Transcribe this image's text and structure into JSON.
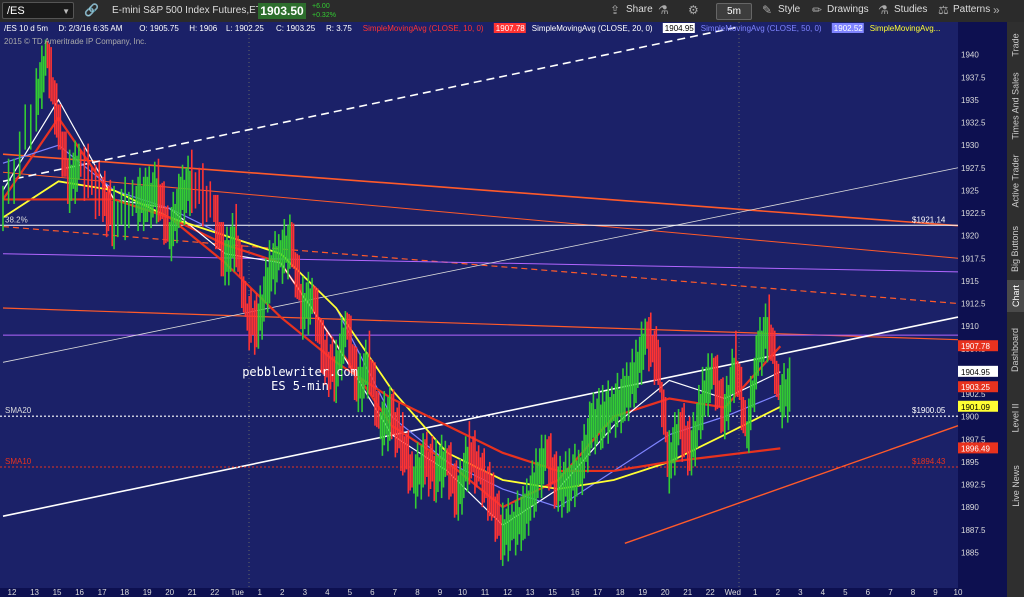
{
  "toolbar": {
    "symbol": "/ES",
    "title": "E-mini S&P 500 Index Futures,ETH",
    "last_price": "1903.50",
    "change_lines": [
      "+6.00",
      "+0.32%"
    ],
    "buttons": {
      "share": "Share",
      "style": "Style",
      "drawings": "Drawings",
      "studies": "Studies",
      "patterns": "Patterns"
    },
    "timeframe": "5m"
  },
  "sidebar": {
    "tabs": [
      "Trade",
      "Times And Sales",
      "Active Trader",
      "Big Buttons",
      "Chart",
      "Dashboard",
      "Level II",
      "Live News"
    ],
    "active": "Chart"
  },
  "header": {
    "info": [
      "/ES 10 d 5m",
      "D: 2/3/16 6:35 AM",
      "O: 1905.75",
      "H: 1906",
      "L: 1902.25",
      "C: 1903.25",
      "R: 3.75"
    ],
    "studies": [
      {
        "label": "SimpleMovingAvg (CLOSE, 10, 0)",
        "value": "1907.78",
        "color": "#ff3333"
      },
      {
        "label": "SimpleMovingAvg (CLOSE, 20, 0)",
        "value": "1904.95",
        "color": "#ffffff"
      },
      {
        "label": "SimpleMovingAvg (CLOSE, 50, 0)",
        "value": "1902.52",
        "color": "#7f84ff"
      },
      {
        "label": "SimpleMovingAvg...",
        "value": "",
        "color": "#ffff33"
      }
    ],
    "copyright": "2015 © TD Ameritrade IP Company, Inc."
  },
  "annotations": {
    "watermark": [
      "pebblewriter.com",
      "ES 5-min"
    ],
    "fib": "38.2%",
    "sma20": "SMA20",
    "sma10": "SMA10",
    "level_1921": "$1921.14",
    "level_1900": "$1900.05",
    "level_1894": "$1894.43"
  },
  "chart_data": {
    "type": "line",
    "title": "/ES 10 d 5m",
    "xlabel": "",
    "ylabel": "",
    "ylim": [
      1882.5,
      1942.5
    ],
    "grid": false,
    "y_ticks": [
      "1885",
      "1887.5",
      "1890",
      "1892.5",
      "1895",
      "1897.5",
      "1900",
      "1902.5",
      "1905",
      "1907.5",
      "1910",
      "1912.5",
      "1915",
      "1917.5",
      "1920",
      "1922.5",
      "1925",
      "1927.5",
      "1930",
      "1932.5",
      "1935",
      "1937.5",
      "1940"
    ],
    "x_ticks": [
      "12",
      "13",
      "15",
      "16",
      "17",
      "18",
      "19",
      "20",
      "21",
      "22",
      "Tue",
      "1",
      "2",
      "3",
      "4",
      "5",
      "6",
      "7",
      "8",
      "9",
      "10",
      "11",
      "12",
      "13",
      "15",
      "16",
      "17",
      "18",
      "19",
      "20",
      "21",
      "22",
      "Wed",
      "1",
      "2",
      "3",
      "4",
      "5",
      "6",
      "7",
      "8",
      "9",
      "10"
    ],
    "price_badges": [
      {
        "value": "1907.78",
        "color": "#e8321e",
        "text_color": "#ffffff"
      },
      {
        "value": "1904.95",
        "color": "#ffffff",
        "text_color": "#000000"
      },
      {
        "value": "1903.25",
        "color": "#e8321e",
        "text_color": "#ffffff"
      },
      {
        "value": "1901.09",
        "color": "#ffff33",
        "text_color": "#000000"
      },
      {
        "value": "1896.49",
        "color": "#e8321e",
        "text_color": "#ffffff"
      }
    ],
    "price_series": [
      [
        0,
        1923
      ],
      [
        3,
        1935
      ],
      [
        4,
        1940
      ],
      [
        5,
        1932
      ],
      [
        6,
        1926
      ],
      [
        7,
        1928
      ],
      [
        9,
        1924
      ],
      [
        10,
        1922
      ],
      [
        12,
        1924
      ],
      [
        13,
        1924
      ],
      [
        14,
        1925
      ],
      [
        15,
        1920
      ],
      [
        16,
        1924
      ],
      [
        17,
        1926
      ],
      [
        19,
        1923
      ],
      [
        20,
        1917
      ],
      [
        21,
        1920
      ],
      [
        22,
        1911
      ],
      [
        23,
        1910
      ],
      [
        24,
        1916
      ],
      [
        25,
        1918
      ],
      [
        26,
        1919
      ],
      [
        27,
        1912
      ],
      [
        28,
        1913
      ],
      [
        29,
        1906
      ],
      [
        30,
        1905
      ],
      [
        31,
        1910
      ],
      [
        32,
        1903
      ],
      [
        33,
        1906
      ],
      [
        34,
        1899
      ],
      [
        35,
        1900
      ],
      [
        36,
        1897
      ],
      [
        37,
        1893
      ],
      [
        38,
        1895
      ],
      [
        39,
        1894
      ],
      [
        40,
        1895
      ],
      [
        41,
        1891
      ],
      [
        42,
        1896
      ],
      [
        43,
        1894
      ],
      [
        44,
        1891
      ],
      [
        45,
        1887
      ],
      [
        46,
        1888
      ],
      [
        47,
        1889
      ],
      [
        48,
        1893
      ],
      [
        49,
        1896
      ],
      [
        50,
        1892
      ],
      [
        51,
        1893
      ],
      [
        52,
        1894
      ],
      [
        53,
        1899
      ],
      [
        54,
        1900
      ],
      [
        55,
        1901
      ],
      [
        56,
        1902
      ],
      [
        57,
        1905
      ],
      [
        58,
        1909
      ],
      [
        59,
        1906
      ],
      [
        60,
        1895
      ],
      [
        61,
        1899
      ],
      [
        62,
        1896
      ],
      [
        63,
        1902
      ],
      [
        64,
        1905
      ],
      [
        65,
        1900
      ],
      [
        66,
        1906
      ],
      [
        67,
        1898
      ],
      [
        68,
        1907
      ],
      [
        69,
        1910
      ],
      [
        70,
        1902
      ],
      [
        71,
        1903.25
      ]
    ],
    "series": [
      {
        "name": "SMA 10",
        "color": "#e83222",
        "values": [
          [
            0,
            1924
          ],
          [
            5,
            1933
          ],
          [
            10,
            1924
          ],
          [
            15,
            1922
          ],
          [
            20,
            1919
          ],
          [
            25,
            1917
          ],
          [
            30,
            1908
          ],
          [
            35,
            1899
          ],
          [
            40,
            1895
          ],
          [
            45,
            1890
          ],
          [
            50,
            1893
          ],
          [
            55,
            1900
          ],
          [
            60,
            1902
          ],
          [
            65,
            1901
          ],
          [
            70,
            1907.78
          ]
        ]
      },
      {
        "name": "SMA 20",
        "color": "#ffffff",
        "values": [
          [
            0,
            1925
          ],
          [
            5,
            1935
          ],
          [
            10,
            1924
          ],
          [
            15,
            1923
          ],
          [
            20,
            1918
          ],
          [
            25,
            1917
          ],
          [
            30,
            1908
          ],
          [
            35,
            1898
          ],
          [
            40,
            1894
          ],
          [
            45,
            1888
          ],
          [
            50,
            1892
          ],
          [
            55,
            1899
          ],
          [
            60,
            1904
          ],
          [
            65,
            1902
          ],
          [
            70,
            1904.95
          ]
        ]
      },
      {
        "name": "SMA 50",
        "color": "#7f84ff",
        "values": [
          [
            0,
            1928
          ],
          [
            5,
            1930
          ],
          [
            10,
            1925
          ],
          [
            15,
            1923
          ],
          [
            20,
            1920
          ],
          [
            25,
            1918
          ],
          [
            30,
            1912
          ],
          [
            35,
            1900
          ],
          [
            40,
            1895
          ],
          [
            45,
            1892
          ],
          [
            50,
            1890
          ],
          [
            55,
            1894
          ],
          [
            60,
            1898
          ],
          [
            65,
            1900
          ],
          [
            70,
            1902.52
          ]
        ]
      },
      {
        "name": "",
        "color": "#ffff33",
        "values": [
          [
            0,
            1922
          ],
          [
            5,
            1926
          ],
          [
            10,
            1925
          ],
          [
            15,
            1922
          ],
          [
            20,
            1920
          ],
          [
            25,
            1918
          ],
          [
            30,
            1912
          ],
          [
            35,
            1903
          ],
          [
            40,
            1896
          ],
          [
            45,
            1893
          ],
          [
            50,
            1892
          ],
          [
            55,
            1893
          ],
          [
            60,
            1895
          ],
          [
            65,
            1898
          ],
          [
            70,
            1901.09
          ]
        ]
      },
      {
        "name": "",
        "color": "#e8321e",
        "values": [
          [
            0,
            1924
          ],
          [
            10,
            1924
          ],
          [
            15,
            1922
          ],
          [
            20,
            1917
          ],
          [
            25,
            1911
          ],
          [
            30,
            1906
          ],
          [
            35,
            1902
          ],
          [
            40,
            1899
          ],
          [
            45,
            1896
          ],
          [
            50,
            1894
          ],
          [
            55,
            1894
          ],
          [
            60,
            1895
          ],
          [
            70,
            1896.49
          ]
        ]
      }
    ]
  }
}
